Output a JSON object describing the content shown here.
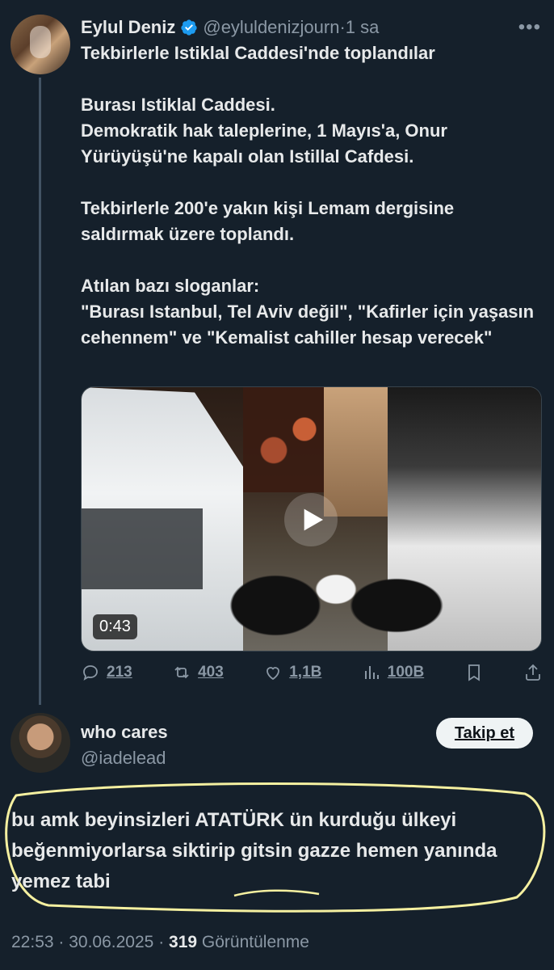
{
  "tweet": {
    "author_name": "Eylul Deniz",
    "handle": "@eyluldenizjourn",
    "separator": "·",
    "time": "1 sa",
    "more_icon": "more-horizontal-icon",
    "text": "Tekbirlerle Istiklal Caddesi'nde toplandılar\n\nBurası Istiklal Caddesi.\nDemokratik hak taleplerine, 1 Mayıs'a, Onur Yürüyüşü'ne kapalı olan Istillal Cafdesi.\n\nTekbirlerle 200'e yakın kişi Lemam dergisine saldırmak üzere toplandı.\n\nAtılan bazı sloganlar:\n\"Burası Istanbul, Tel Aviv değil\", \"Kafirler için yaşasın cehennem\" ve \"Kemalist cahiller hesap verecek\"",
    "video_duration": "0:43",
    "stats": {
      "replies": "213",
      "reposts": "403",
      "likes": "1,1B",
      "views": "100B"
    }
  },
  "reply": {
    "author_name": "who cares",
    "handle": "@iadelead",
    "follow_label": "Takip et",
    "text": "bu amk beyinsizleri ATATÜRK ün kurduğu ülkeyi beğenmiyorlarsa siktirip gitsin gazze hemen yanında yemez tabi",
    "time": "22:53",
    "date": "30.06.2025",
    "views_count": "319",
    "views_label": "Görüntülenme"
  },
  "colors": {
    "background": "#15202b",
    "text": "#e7e9ea",
    "muted": "#8b98a5",
    "verified": "#1d9bf0",
    "highlight_marker": "#f5f0a0"
  }
}
